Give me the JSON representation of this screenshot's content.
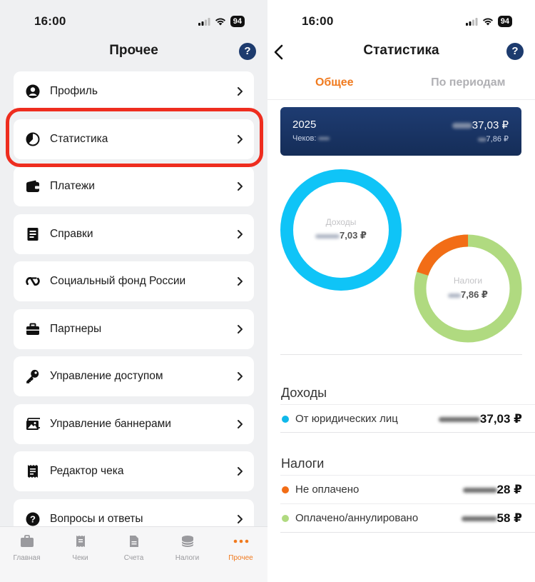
{
  "left": {
    "status": {
      "time": "16:00",
      "battery": "94"
    },
    "title": "Прочее",
    "help": "?",
    "menu": [
      {
        "label": "Профиль",
        "icon": "profile-icon"
      },
      {
        "label": "Статистика",
        "icon": "pie-chart-icon"
      },
      {
        "label": "Платежи",
        "icon": "wallet-icon"
      },
      {
        "label": "Справки",
        "icon": "document-icon"
      },
      {
        "label": "Социальный фонд России",
        "icon": "sfr-logo-icon"
      },
      {
        "label": "Партнеры",
        "icon": "briefcase-icon"
      },
      {
        "label": "Управление доступом",
        "icon": "key-icon"
      },
      {
        "label": "Управление баннерами",
        "icon": "image-icon"
      },
      {
        "label": "Редактор чека",
        "icon": "receipt-icon"
      },
      {
        "label": "Вопросы и ответы",
        "icon": "question-icon"
      }
    ],
    "tabs": [
      {
        "label": "Главная",
        "icon": "home-icon"
      },
      {
        "label": "Чеки",
        "icon": "receipts-icon"
      },
      {
        "label": "Счета",
        "icon": "invoice-icon"
      },
      {
        "label": "Налоги",
        "icon": "coins-icon"
      },
      {
        "label": "Прочее",
        "icon": "more-icon"
      }
    ],
    "accent": "#f07a1e",
    "highlight_color": "#ee2d1f"
  },
  "right": {
    "status": {
      "time": "16:00",
      "battery": "94"
    },
    "title": "Статистика",
    "help": "?",
    "segments": [
      "Общее",
      "По периодам"
    ],
    "year_card": {
      "year": "2025",
      "checks_label": "Чеков:",
      "amount_suffix": "37,03 ₽",
      "amount2_suffix": "7,86 ₽"
    },
    "income_ring": {
      "label": "Доходы",
      "value_suffix": "7,03 ₽",
      "color": "#0fc4f7"
    },
    "tax_ring": {
      "label": "Налоги",
      "value_suffix": "7,86 ₽",
      "unpaid_fraction": 0.2,
      "unpaid_color": "#f26d16",
      "paid_color": "#b0da80"
    },
    "income_section": {
      "title": "Доходы",
      "rows": [
        {
          "label": "От юридических лиц",
          "value_suffix": "37,03 ₽",
          "color": "#10b8ea"
        }
      ]
    },
    "tax_section": {
      "title": "Налоги",
      "rows": [
        {
          "label": "Не оплачено",
          "value_suffix": "28 ₽",
          "color": "#f26d16"
        },
        {
          "label": "Оплачено/аннулировано",
          "value_suffix": "58 ₽",
          "color": "#b0da80"
        }
      ]
    }
  }
}
